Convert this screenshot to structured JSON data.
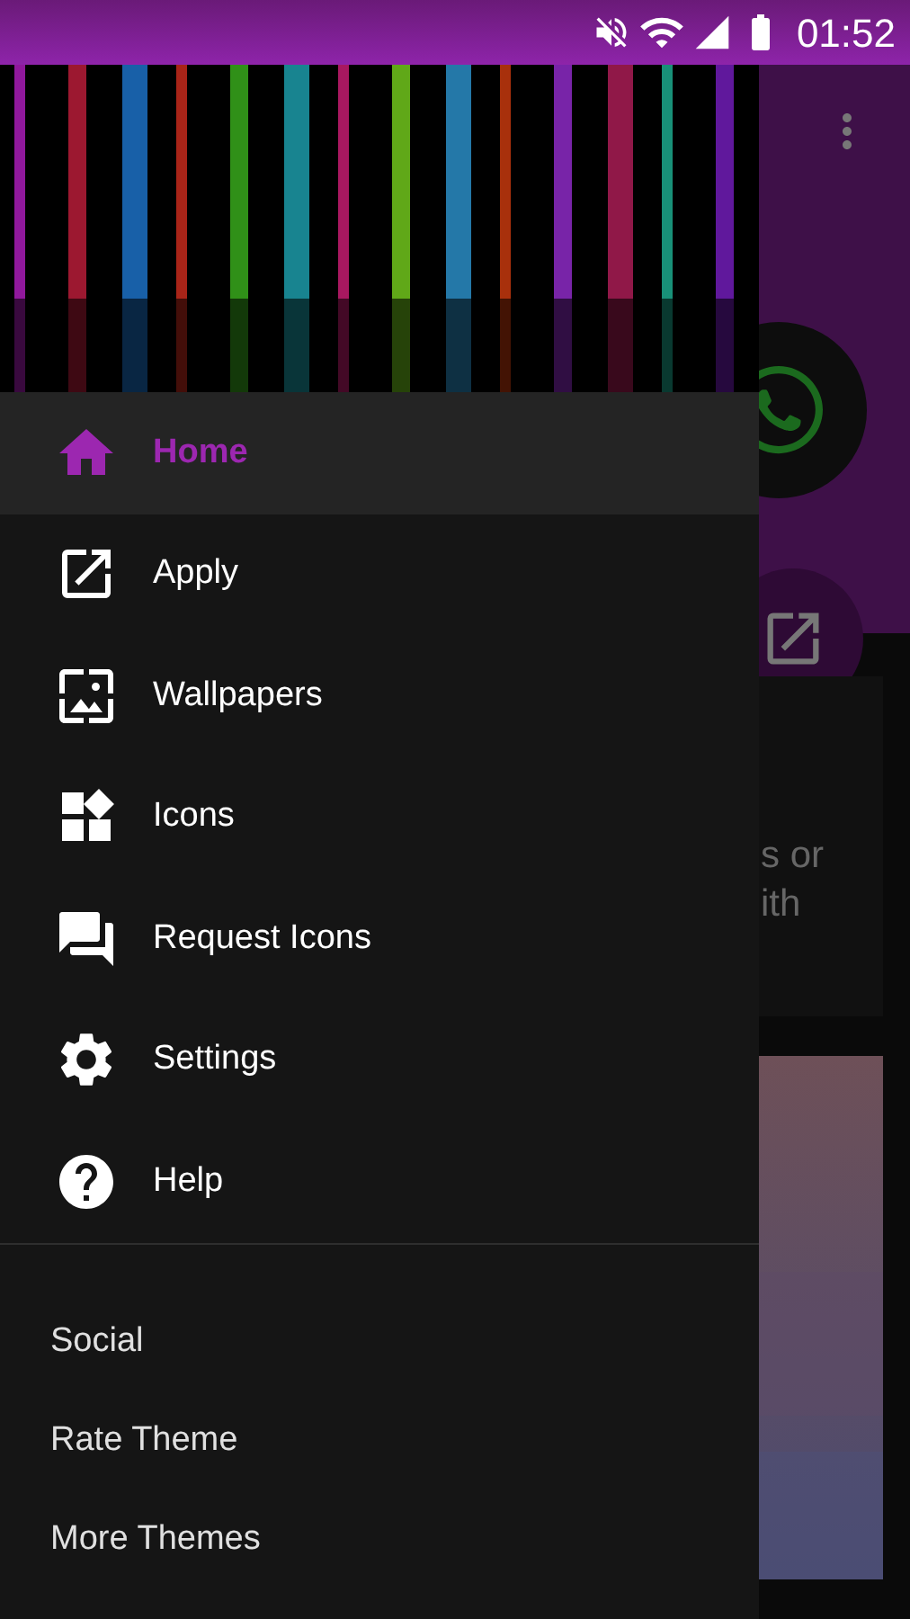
{
  "status_bar": {
    "time": "01:52"
  },
  "drawer": {
    "nav_items": [
      {
        "label": "Home",
        "kind": "home",
        "selected": true
      },
      {
        "label": "Apply",
        "kind": "apply",
        "selected": false
      },
      {
        "label": "Wallpapers",
        "kind": "wallpapers",
        "selected": false
      },
      {
        "label": "Icons",
        "kind": "icons",
        "selected": false
      },
      {
        "label": "Request Icons",
        "kind": "request",
        "selected": false
      },
      {
        "label": "Settings",
        "kind": "settings",
        "selected": false
      },
      {
        "label": "Help",
        "kind": "help",
        "selected": false
      }
    ],
    "secondary_items": [
      "Social",
      "Rate Theme",
      "More Themes"
    ]
  },
  "background_card": {
    "lines": [
      "s or",
      "ith"
    ]
  }
}
